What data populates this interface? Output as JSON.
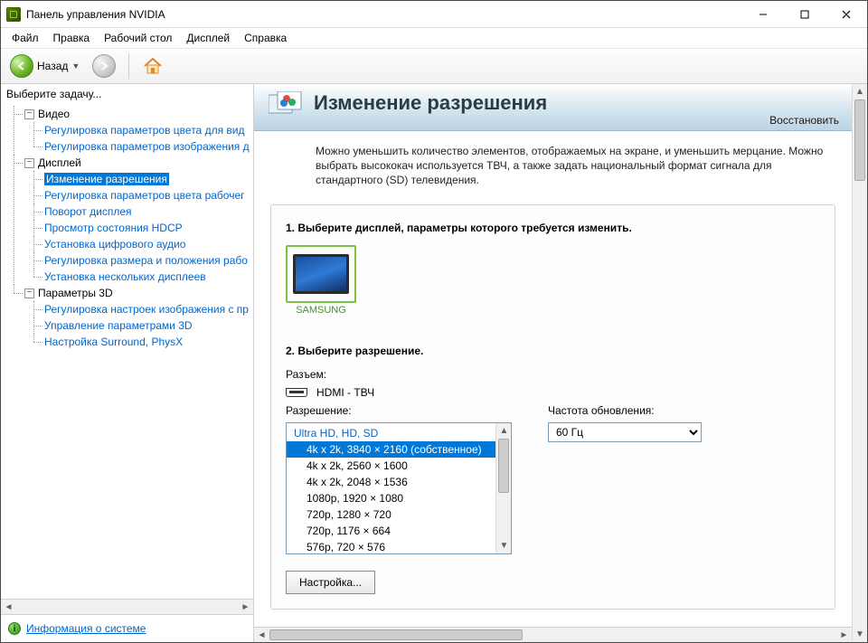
{
  "window": {
    "title": "Панель управления NVIDIA"
  },
  "menu": {
    "items": [
      "Файл",
      "Правка",
      "Рабочий стол",
      "Дисплей",
      "Справка"
    ]
  },
  "toolbar": {
    "back_label": "Назад"
  },
  "sidebar": {
    "task_header": "Выберите задачу...",
    "groups": [
      {
        "label": "Видео",
        "items": [
          "Регулировка параметров цвета для вид",
          "Регулировка параметров изображения д"
        ]
      },
      {
        "label": "Дисплей",
        "items": [
          "Изменение разрешения",
          "Регулировка параметров цвета рабочег",
          "Поворот дисплея",
          "Просмотр состояния HDCP",
          "Установка цифрового аудио",
          "Регулировка размера и положения рабо",
          "Установка нескольких дисплеев"
        ],
        "selected": 0
      },
      {
        "label": "Параметры 3D",
        "items": [
          "Регулировка настроек изображения с пр",
          "Управление параметрами 3D",
          "Настройка Surround, PhysX"
        ]
      }
    ],
    "footer_link": "Информация о системе"
  },
  "main": {
    "title": "Изменение разрешения",
    "restore": "Восстановить",
    "description": "Можно уменьшить количество элементов, отображаемых на экране, и уменьшить мерцание. Можно выбрать высококач используется ТВЧ, а также задать национальный формат сигнала для стандартного (SD) телевидения.",
    "step1": "1. Выберите дисплей, параметры которого требуется изменить.",
    "display_name": "SAMSUNG",
    "step2": "2. Выберите разрешение.",
    "connector_label": "Разъем:",
    "connector_value": "HDMI - ТВЧ",
    "resolution_label": "Разрешение:",
    "refresh_label": "Частота обновления:",
    "refresh_value": "60 Гц",
    "resolutions": {
      "group": "Ultra HD, HD, SD",
      "items": [
        "4k x 2k, 3840 × 2160 (собственное)",
        "4k x 2k, 2560 × 1600",
        "4k x 2k, 2048 × 1536",
        "1080p, 1920 × 1080",
        "720p, 1280 × 720",
        "720p, 1176 × 664",
        "576p, 720 × 576"
      ],
      "selected": 0
    },
    "customize_button": "Настройка..."
  }
}
